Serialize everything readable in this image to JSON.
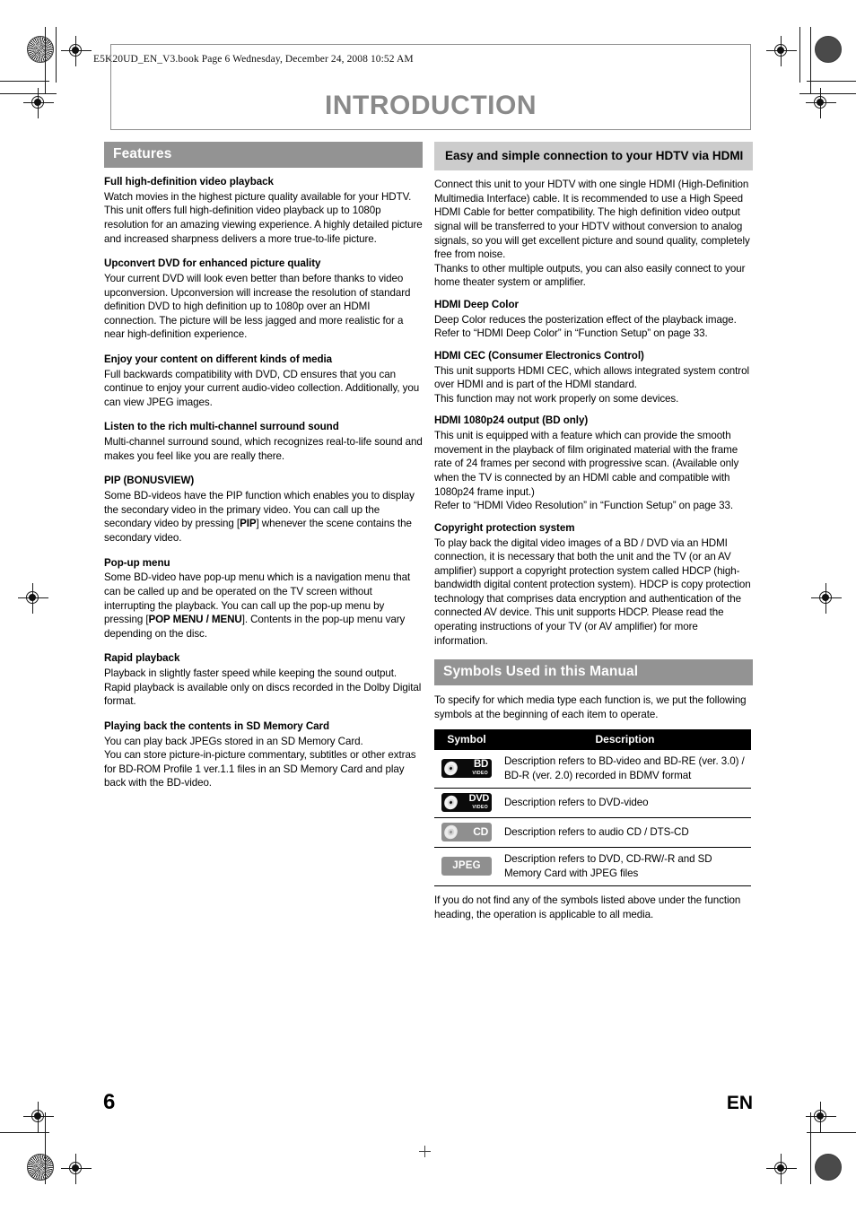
{
  "header": {
    "book_meta": "E5K20UD_EN_V3.book  Page 6  Wednesday, December 24, 2008  10:52 AM",
    "page_title": "INTRODUCTION"
  },
  "left_column": {
    "section_title": "Features",
    "blocks": [
      {
        "heading": "Full high-definition video playback",
        "paragraphs": [
          "Watch movies in the highest picture quality available for your HDTV. This unit offers full high-definition video playback up to 1080p resolution for an amazing viewing experience. A highly detailed picture and increased sharpness delivers a more true-to-life picture."
        ]
      },
      {
        "heading": "Upconvert DVD for enhanced picture quality",
        "paragraphs": [
          "Your current DVD will look even better than before thanks to video upconversion. Upconversion will increase the resolution of standard definition DVD to high definition up to 1080p over an HDMI connection. The picture will be less jagged and more realistic for a near high-definition experience."
        ]
      },
      {
        "heading": "Enjoy your content on different kinds of media",
        "paragraphs": [
          "Full backwards compatibility with DVD, CD ensures that you can continue to enjoy your current audio-video collection. Additionally, you can view JPEG images."
        ]
      },
      {
        "heading": "Listen to the rich multi-channel surround sound",
        "paragraphs": [
          "Multi-channel surround sound, which recognizes real-to-life sound and makes you feel like you are really there."
        ]
      },
      {
        "heading": "PIP (BONUSVIEW)",
        "paragraphs": [
          "Some BD-videos have the PIP function which enables you to display the secondary video in the primary video. You can call up the secondary video by pressing [PIP] whenever the scene contains the secondary video."
        ],
        "key_label": "PIP"
      },
      {
        "heading": "Pop-up menu",
        "paragraphs": [
          "Some BD-video have pop-up menu which is a navigation menu that can be called up and be operated on the TV screen without interrupting the playback. You can call up the pop-up menu by pressing [POP MENU / MENU]. Contents in the pop-up menu vary depending on the disc."
        ],
        "key_label": "POP MENU / MENU"
      },
      {
        "heading": "Rapid playback",
        "paragraphs": [
          "Playback in slightly faster speed while keeping the sound output.",
          "Rapid playback is available only on discs recorded in the Dolby Digital format."
        ]
      },
      {
        "heading": "Playing back the contents in SD Memory Card",
        "paragraphs": [
          "You can play back JPEGs stored in an SD Memory Card.",
          "You can store picture-in-picture commentary, subtitles or other extras for BD-ROM Profile 1 ver.1.1 files in an SD Memory Card and play back with the BD-video."
        ]
      }
    ]
  },
  "right_column": {
    "section_title": "Easy and simple connection to your HDTV via HDMI",
    "intro_paragraphs": [
      "Connect this unit to your HDTV with one single HDMI (High-Definition Multimedia Interface) cable. It is recommended to use a High Speed HDMI Cable for better compatibility. The high definition video output signal will be transferred to your HDTV without conversion to analog signals, so you will get excellent picture and sound quality, completely free from noise.",
      "Thanks to other multiple outputs, you can also easily connect to your home theater system or amplifier."
    ],
    "blocks": [
      {
        "heading": "HDMI Deep Color",
        "paragraphs": [
          "Deep Color reduces the posterization effect of the playback image. Refer to “HDMI Deep Color” in “Function Setup” on page 33."
        ]
      },
      {
        "heading": "HDMI CEC (Consumer Electronics Control)",
        "paragraphs": [
          "This unit supports HDMI CEC, which allows integrated system control over HDMI and is part of the HDMI standard.",
          "This function may not work properly on some devices."
        ]
      },
      {
        "heading": "HDMI 1080p24 output (BD only)",
        "paragraphs": [
          "This unit is equipped with a feature which can provide the smooth movement in the playback of film originated material with the frame rate of 24 frames per second with progressive scan. (Available only when the TV is connected by an HDMI cable and compatible with 1080p24 frame input.)",
          "Refer to “HDMI Video Resolution” in “Function Setup” on page 33."
        ]
      },
      {
        "heading": "Copyright protection system",
        "paragraphs": [
          "To play back the digital video images of a BD / DVD via an HDMI connection, it is necessary that both the unit and the TV (or an AV amplifier) support a copyright protection system called HDCP (high-bandwidth digital content protection system). HDCP is copy protection technology that comprises data encryption and authentication of the connected AV device. This unit supports HDCP. Please read the operating instructions of your TV (or AV amplifier) for more information."
        ]
      }
    ],
    "symbols_section": {
      "section_title": "Symbols Used in this Manual",
      "intro": "To specify for which media type each function is, we put the following symbols at the beginning of each item to operate.",
      "table_headers": {
        "symbol": "Symbol",
        "description": "Description"
      },
      "rows": [
        {
          "icon_name": "bd-video-badge",
          "badge_main": "BD",
          "badge_sub": "VIDEO",
          "description": "Description refers to BD-video and BD-RE (ver. 3.0) / BD-R (ver. 2.0) recorded in BDMV format"
        },
        {
          "icon_name": "dvd-video-badge",
          "badge_main": "DVD",
          "badge_sub": "VIDEO",
          "description": "Description refers to DVD-video"
        },
        {
          "icon_name": "cd-badge",
          "badge_main": "CD",
          "badge_sub": "",
          "description": "Description refers to audio CD / DTS-CD"
        },
        {
          "icon_name": "jpeg-badge",
          "badge_main": "JPEG",
          "badge_sub": "",
          "description": "Description refers to DVD, CD-RW/-R and SD Memory Card with JPEG files"
        }
      ],
      "note": "If you do not find any of the symbols listed above under the function heading, the operation is applicable to all media."
    }
  },
  "footer": {
    "page_number": "6",
    "language": "EN"
  },
  "colors": {
    "section_bar_dark": "#939393",
    "section_bar_light": "#cccccc",
    "title_gray": "#8a8a8a",
    "table_header_bg": "#000000",
    "badge_dark": "#0b0b0b",
    "badge_grey": "#8f8f8f"
  }
}
